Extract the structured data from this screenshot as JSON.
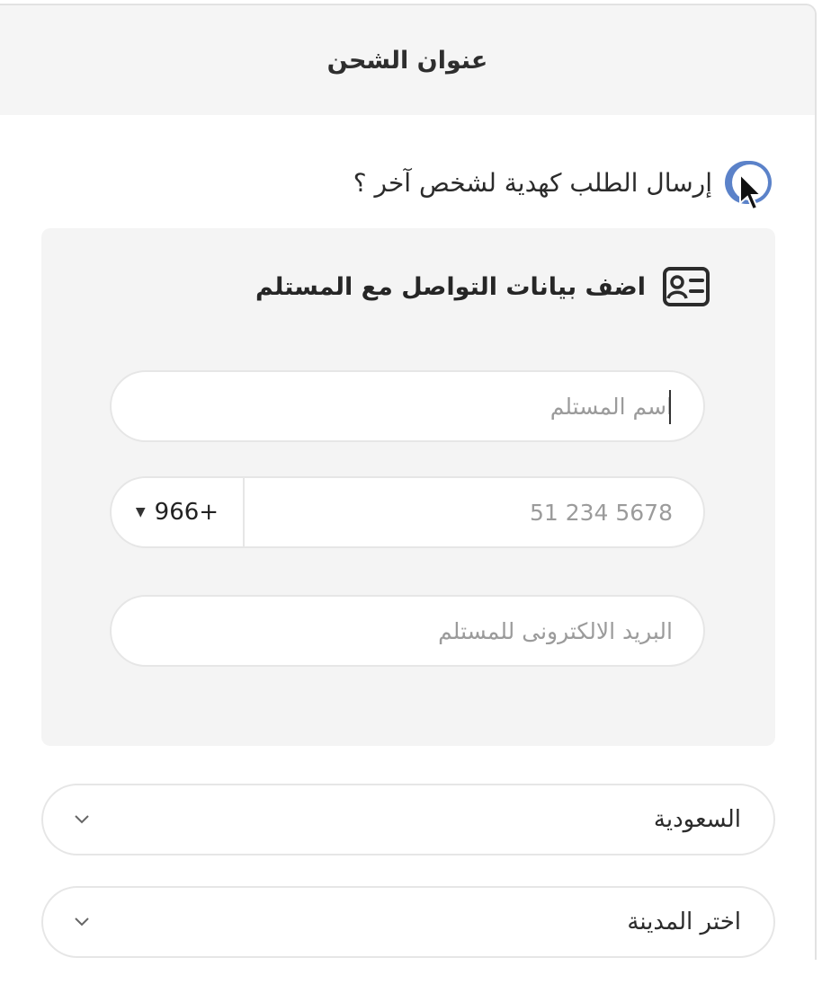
{
  "header": {
    "title": "عنوان الشحن"
  },
  "gift": {
    "label": "إرسال الطلب كهدية لشخص آخر ؟",
    "enabled": true
  },
  "contact": {
    "heading": "اضف بيانات التواصل مع المستلم",
    "name_placeholder": "اسم المستلم",
    "phone_code": "966+",
    "phone_placeholder": "5678 234 51",
    "email_placeholder": "البريد الالكترونى للمستلم"
  },
  "country_select": {
    "value": "السعودية"
  },
  "city_select": {
    "value": "اختر المدينة"
  },
  "colors": {
    "toggle_on": "#5b82c9",
    "panel_bg": "#f4f4f4",
    "header_bg": "#f5f5f5"
  }
}
